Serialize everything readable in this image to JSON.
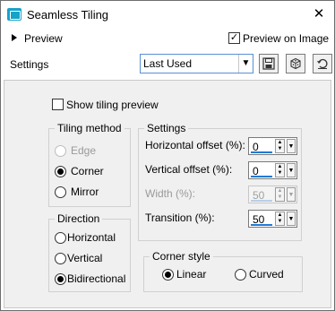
{
  "window": {
    "title": "Seamless Tiling",
    "close_glyph": "✕"
  },
  "preview": {
    "label": "Preview",
    "preview_on_image_label": "Preview on Image",
    "preview_on_image_checked": true
  },
  "settings_bar": {
    "label": "Settings",
    "preset_value": "Last Used",
    "buttons": [
      "save-preset-icon",
      "randomize-icon",
      "reset-icon"
    ]
  },
  "options": {
    "show_tiling_preview_label": "Show tiling preview",
    "show_tiling_preview_checked": false
  },
  "tiling_method": {
    "title": "Tiling method",
    "options": [
      {
        "label": "Edge",
        "checked": false,
        "disabled": true
      },
      {
        "label": "Corner",
        "checked": true,
        "disabled": false
      },
      {
        "label": "Mirror",
        "checked": false,
        "disabled": false
      }
    ]
  },
  "direction": {
    "title": "Direction",
    "options": [
      {
        "label": "Horizontal",
        "checked": false
      },
      {
        "label": "Vertical",
        "checked": false
      },
      {
        "label": "Bidirectional",
        "checked": true
      }
    ]
  },
  "settings_group": {
    "title": "Settings",
    "fields": [
      {
        "label": "Horizontal offset (%):",
        "value": "0",
        "disabled": false,
        "level": 0
      },
      {
        "label": "Vertical offset (%):",
        "value": "0",
        "disabled": false,
        "level": 0
      },
      {
        "label": "Width (%):",
        "value": "50",
        "disabled": true,
        "level": 50
      },
      {
        "label": "Transition (%):",
        "value": "50",
        "disabled": false,
        "level": 50
      }
    ]
  },
  "corner_style": {
    "title": "Corner style",
    "options": [
      {
        "label": "Linear",
        "checked": true
      },
      {
        "label": "Curved",
        "checked": false
      }
    ]
  },
  "colors": {
    "accent": "#1f7ad6",
    "title_icon": "#16a2c9"
  }
}
